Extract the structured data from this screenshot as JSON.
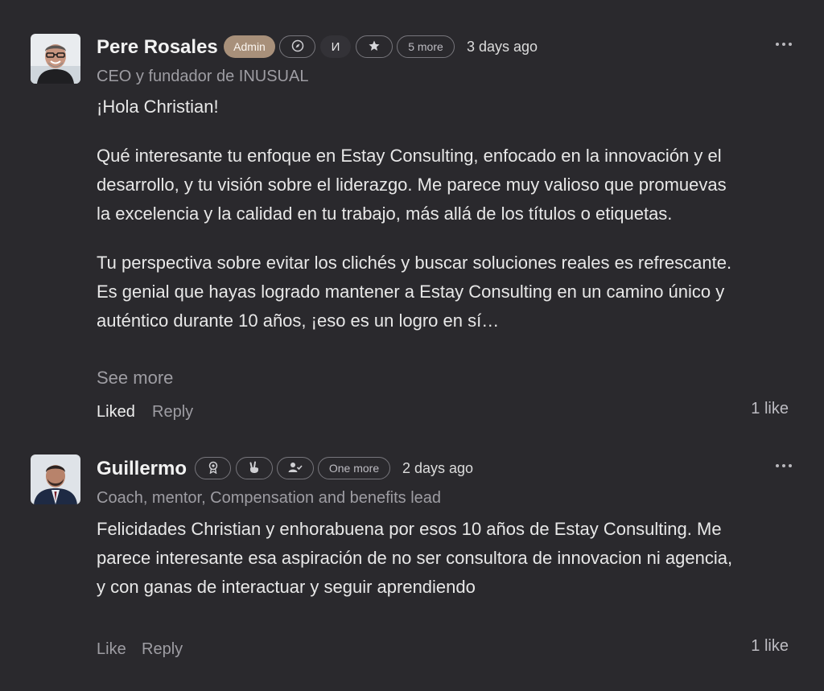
{
  "comments": [
    {
      "author": "Pere Rosales",
      "role_badge": "Admin",
      "badge_icons": [
        "compass-icon",
        "cyrillic-letter-icon",
        "star-icon"
      ],
      "cyrillic_glyph": "И",
      "more_badges": "5 more",
      "time": "3 days ago",
      "subtitle": "CEO y fundador de INUSUAL",
      "paragraphs": [
        "¡Hola Christian!",
        "Qué interesante tu enfoque en Estay Consulting, enfocado en la innovación y el desarrollo, y tu visión sobre el liderazgo. Me parece muy valioso que promuevas la excelencia y la calidad en tu trabajo, más allá de los títulos o etiquetas.",
        "Tu perspectiva sobre evitar los clichés y buscar soluciones reales es refrescante. Es genial que hayas logrado mantener a Estay Consulting en un camino único y auténtico durante 10 años, ¡eso es un logro en sí…"
      ],
      "see_more": "See more",
      "like_label": "Liked",
      "reply_label": "Reply",
      "likes_count": "1 like"
    },
    {
      "author": "Guillermo",
      "badge_icons": [
        "award-ribbon-icon",
        "peace-hand-icon",
        "user-check-icon"
      ],
      "more_badges": "One more",
      "time": "2 days ago",
      "subtitle": "Coach, mentor, Compensation and benefits lead",
      "paragraphs": [
        "Felicidades Christian y enhorabuena por esos 10 años de Estay Consulting. Me parece interesante esa aspiración de no ser consultora de innovacion ni agencia, y con ganas de interactuar y seguir aprendiendo"
      ],
      "like_label": "Like",
      "reply_label": "Reply",
      "likes_count": "1 like"
    }
  ]
}
